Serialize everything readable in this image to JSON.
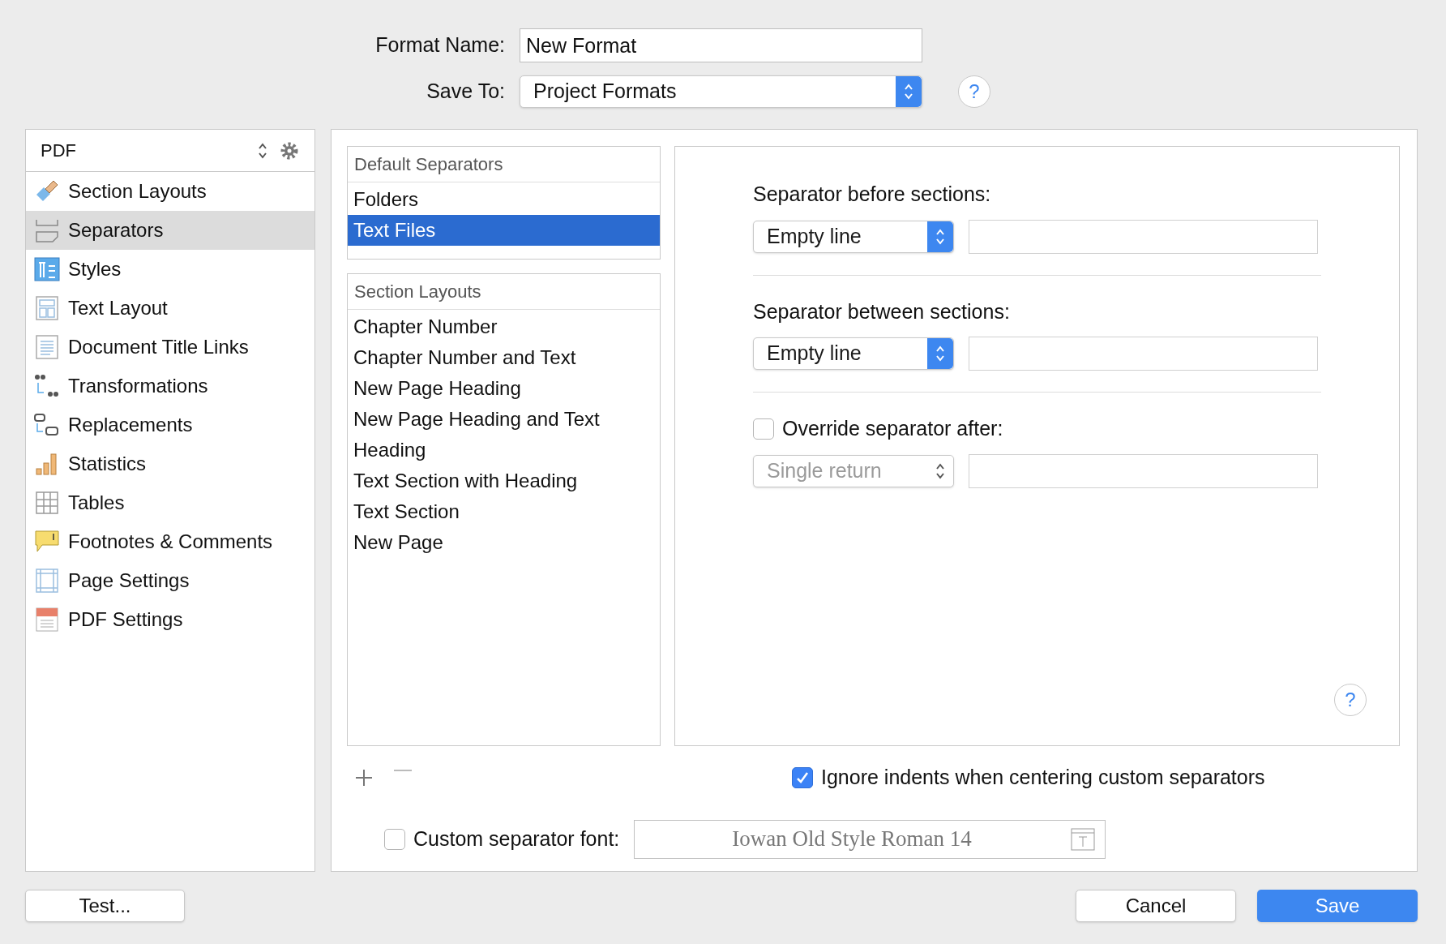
{
  "header": {
    "format_name": {
      "label": "Format Name:",
      "value": "New Format"
    },
    "save_to": {
      "label": "Save To:",
      "value": "Project Formats"
    }
  },
  "sidebar": {
    "selector": "PDF",
    "items": [
      {
        "label": "Section Layouts",
        "selected": false
      },
      {
        "label": "Separators",
        "selected": true
      },
      {
        "label": "Styles",
        "selected": false
      },
      {
        "label": "Text Layout",
        "selected": false
      },
      {
        "label": "Document Title Links",
        "selected": false
      },
      {
        "label": "Transformations",
        "selected": false
      },
      {
        "label": "Replacements",
        "selected": false
      },
      {
        "label": "Statistics",
        "selected": false
      },
      {
        "label": "Tables",
        "selected": false
      },
      {
        "label": "Footnotes & Comments",
        "selected": false
      },
      {
        "label": "Page Settings",
        "selected": false
      },
      {
        "label": "PDF Settings",
        "selected": false
      }
    ]
  },
  "default_separators": {
    "title": "Default Separators",
    "items": [
      {
        "label": "Folders",
        "selected": false
      },
      {
        "label": "Text Files",
        "selected": true
      }
    ]
  },
  "section_layouts": {
    "title": "Section Layouts",
    "items": [
      {
        "label": "Chapter Number",
        "selected": false
      },
      {
        "label": "Chapter Number and Text",
        "selected": false
      },
      {
        "label": "New Page Heading",
        "selected": false
      },
      {
        "label": "New Page Heading and Text",
        "selected": false
      },
      {
        "label": "Heading",
        "selected": false
      },
      {
        "label": "Text Section with Heading",
        "selected": false
      },
      {
        "label": "Text Section",
        "selected": false
      },
      {
        "label": "New Page",
        "selected": false
      }
    ]
  },
  "settings": [
    {
      "kind": "heading",
      "label": "Separator before sections:",
      "value": "Empty line",
      "disabled": false
    },
    {
      "kind": "heading",
      "label": "Separator between sections:",
      "value": "Empty line",
      "disabled": false
    },
    {
      "kind": "checkbox",
      "label": "Override separator after:",
      "checked": false,
      "value": "Single return",
      "disabled": true
    }
  ],
  "ignore_indents": {
    "label": "Ignore indents when centering custom separators",
    "checked": true
  },
  "custom_font": {
    "label": "Custom separator font:",
    "checked": false,
    "value": "Iowan Old Style Roman 14"
  },
  "help_buttons": [
    "?",
    "?"
  ],
  "buttons": {
    "test": "Test...",
    "cancel": "Cancel",
    "save": "Save"
  }
}
